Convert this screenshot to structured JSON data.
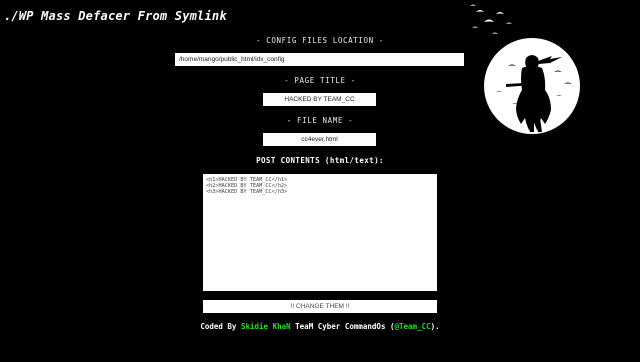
{
  "header": {
    "title": "./WP Mass Defacer From Symlink"
  },
  "config": {
    "label": "- CONFIG FILES LOCATION -",
    "value": "/home/mango/public_html/idx_config"
  },
  "page_title": {
    "label": "- PAGE TITLE -",
    "value": "HACKED BY TEAM_CC"
  },
  "file_name": {
    "label": "- FILE NAME -",
    "value": "cc4ever.html"
  },
  "post": {
    "label": "POST CONTENTS (html/text):",
    "value": "<h1>HACKED BY TEAM_CC</h1>\n<h2>HACKED BY TEAM_CC</h2>\n<h3>HACKED BY TEAM_CC</h3>"
  },
  "submit": {
    "label": "!! CHANGE THEM !!"
  },
  "footer": {
    "prefix": "Coded By ",
    "author": "Skidie KhaN",
    "middle": " TeaM Cyber CommandOs (",
    "handle": "@Team_CC",
    "suffix": ")."
  },
  "colors": {
    "background": "#000000",
    "accent": "#16e516"
  },
  "icons": {
    "art": "moon-ninja-crows-icon"
  }
}
